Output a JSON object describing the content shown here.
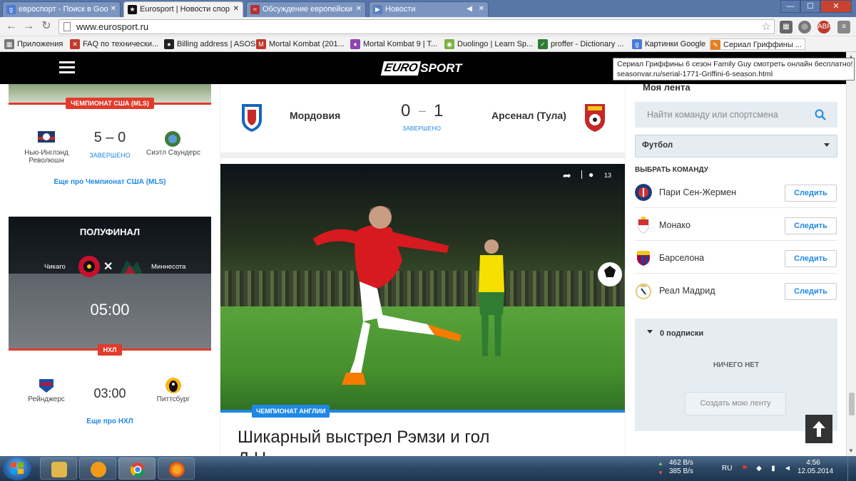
{
  "browser": {
    "tabs": [
      {
        "title": "евроспорт - Поиск в Goo",
        "icon": "google-icon",
        "color": "#4a7bd6",
        "active": false
      },
      {
        "title": "Eurosport | Новости спор",
        "icon": "eurosport-icon",
        "color": "#111111",
        "active": true
      },
      {
        "title": "Обсуждение европейски",
        "icon": "forum-icon",
        "color": "#b23232",
        "active": false
      },
      {
        "title": "Новости",
        "icon": "news-icon",
        "color": "#5a7fc0",
        "active": false
      }
    ],
    "window_controls": {
      "minimize": "—",
      "maximize": "☐",
      "close": "✕"
    },
    "url": "www.eurosport.ru",
    "bookmarks": [
      {
        "label": "Приложения",
        "icon": "apps-icon",
        "color": "#777777"
      },
      {
        "label": "FAQ по технически...",
        "icon": "faq-icon",
        "color": "#c0392b"
      },
      {
        "label": "Billing address | ASOS",
        "icon": "asos-icon",
        "color": "#222222"
      },
      {
        "label": "Mortal Kombat (201...",
        "icon": "mk-icon",
        "color": "#c0392b"
      },
      {
        "label": "Mortal Kombat 9 | T...",
        "icon": "mk9-icon",
        "color": "#8e44ad"
      },
      {
        "label": "Duolingo | Learn Sp...",
        "icon": "duolingo-icon",
        "color": "#7cb342"
      },
      {
        "label": "proffer - Dictionary ...",
        "icon": "check-icon",
        "color": "#2e7d32"
      },
      {
        "label": "Картинки Google",
        "icon": "google-icon",
        "color": "#4a7bd6"
      },
      {
        "label": "Сериал Гриффины ...",
        "icon": "seasonvar-icon",
        "color": "#e67e22"
      }
    ],
    "tooltip": {
      "line1": "Сериал Гриффины 6 сезон Family Guy смотреть онлайн бесплатно!",
      "line2": "seasonvar.ru/serial-1771-Griffini-6-season.html"
    }
  },
  "site": {
    "logo_part1": "EURO",
    "logo_part2": "SPORT"
  },
  "left": {
    "mls_badge": "ЧЕМПИОНАТ США (MLS)",
    "mls_match": {
      "home": "Нью-Инглэнд Революшн",
      "away": "Сиэтл Саундерс",
      "score": "5 – 0",
      "status": "ЗАВЕРШЕНО",
      "home_color": "#1f3a6b",
      "away_color": "#3c7a3a"
    },
    "mls_more": "Еще про Чемпионат США (MLS)",
    "nhl_promo": {
      "title": "ПОЛУФИНАЛ",
      "home": "Чикаго",
      "away": "Миннесота",
      "time": "05:00"
    },
    "nhl_badge": "НХЛ",
    "nhl_match": {
      "home": "Рейнджерс",
      "away": "Питтсбург",
      "time": "03:00",
      "home_color": "#1e4fa3",
      "away_color": "#222222"
    },
    "nhl_more": "Еще про НХЛ"
  },
  "middle": {
    "score": {
      "home": "Мордовия",
      "away": "Арсенал (Тула)",
      "home_goals": "0",
      "dash": "–",
      "away_goals": "1",
      "status": "ЗАВЕРШЕНО"
    },
    "photo": {
      "share_icon": "share-icon",
      "comments": "13",
      "badge": "ЧЕМПИОНАТ АНГЛИИ"
    },
    "article_title_line1": "Шикарный выстрел Рэмзи и гол",
    "article_title_line2": "Д                              Н"
  },
  "right": {
    "title": "Моя лента",
    "search_placeholder": "Найти команду или спортсмена",
    "sport_select": "Футбол",
    "choose_team": "ВЫБРАТЬ КОМАНДУ",
    "teams": [
      {
        "name": "Пари Сен-Жермен",
        "button": "Следить",
        "color": "#1b3b7a"
      },
      {
        "name": "Монако",
        "button": "Следить",
        "color": "#d32f2f"
      },
      {
        "name": "Барселона",
        "button": "Следить",
        "color": "#a50044"
      },
      {
        "name": "Реал Мадрид",
        "button": "Следить",
        "color": "#e0c97a"
      }
    ],
    "subscriptions": {
      "header": "0 подписки",
      "nothing": "НИЧЕГО НЕТ",
      "create": "Создать мою ленту"
    }
  },
  "taskbar": {
    "net_up": "462 B/s",
    "net_down": "385 B/s",
    "time": "4:56",
    "date": "12.05.2014",
    "tray_lang": "RU"
  }
}
